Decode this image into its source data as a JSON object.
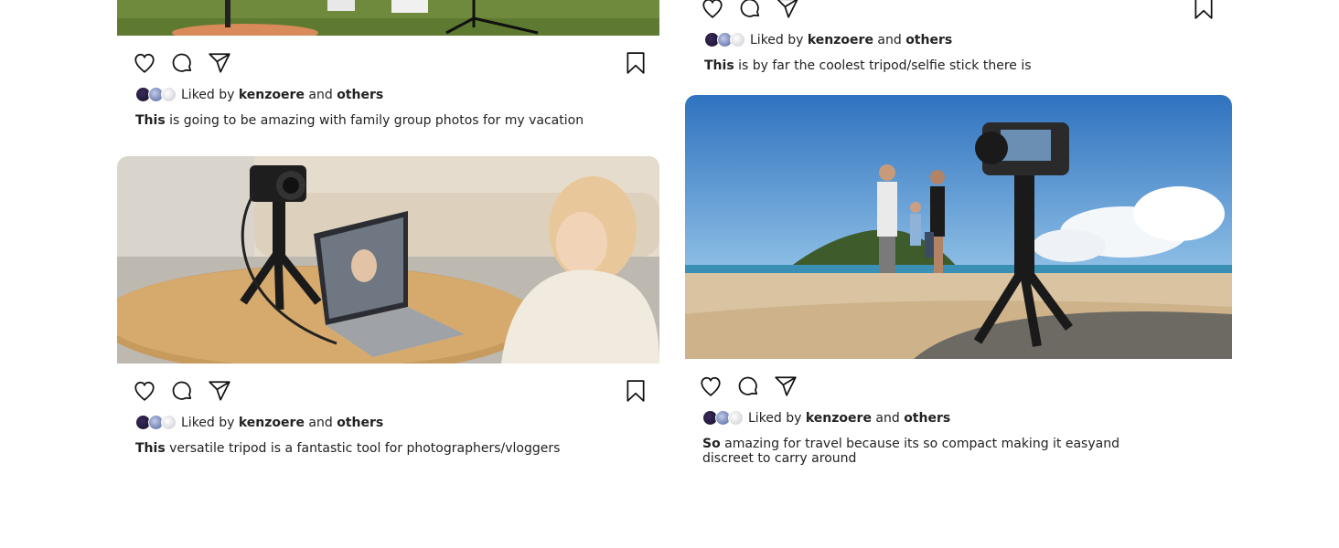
{
  "posts": [
    {
      "liked_prefix": "Liked by",
      "liked_user": "kenzoere",
      "liked_and": "and",
      "liked_others": "others",
      "caption_lead": "This",
      "caption_rest": "is going to be amazing with family group photos for my vacation"
    },
    {
      "liked_prefix": "Liked by",
      "liked_user": "kenzoere",
      "liked_and": "and",
      "liked_others": "others",
      "caption_lead": "This",
      "caption_rest": "versatile tripod is a fantastic tool for photographers/vloggers"
    },
    {
      "liked_prefix": "Liked by",
      "liked_user": "kenzoere",
      "liked_and": "and",
      "liked_others": "others",
      "caption_lead": "This",
      "caption_rest": "is by far the coolest tripod/selfie stick there is"
    },
    {
      "liked_prefix": "Liked by",
      "liked_user": "kenzoere",
      "liked_and": "and",
      "liked_others": "others",
      "caption_lead": "So",
      "caption_rest": "amazing for travel because its so compact making it easyand discreet to carry around"
    }
  ],
  "icons": [
    "heart-icon",
    "comment-icon",
    "share-icon",
    "bookmark-icon"
  ],
  "colors": {
    "text": "#222222",
    "background": "#ffffff",
    "sky": "#3f83c6",
    "sand": "#d9c3a0",
    "grass": "#6f8a3c"
  }
}
